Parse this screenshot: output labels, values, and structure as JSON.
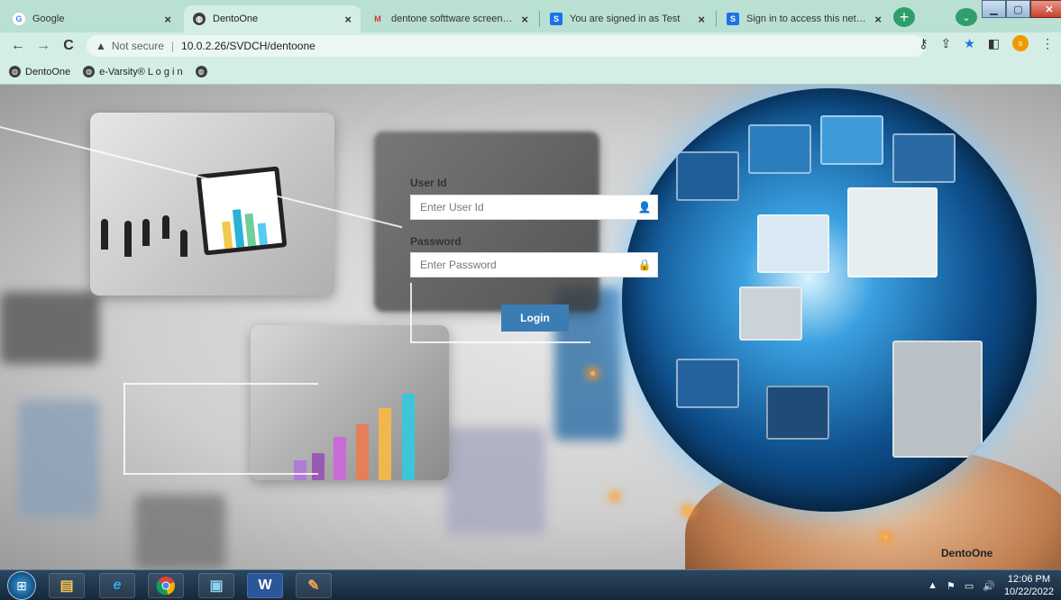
{
  "browser": {
    "tabs": [
      {
        "title": "Google",
        "icon": "google-icon"
      },
      {
        "title": "DentoOne",
        "icon": "globe-icon",
        "active": true
      },
      {
        "title": "dentone softtware screenshot",
        "icon": "gmail-icon"
      },
      {
        "title": "You are signed in as Test",
        "icon": "s-icon"
      },
      {
        "title": "Sign in to access this network",
        "icon": "s-icon"
      }
    ],
    "new_tab_label": "+",
    "address": {
      "security": "Not secure",
      "url": "10.0.2.26/SVDCH/dentoone"
    },
    "profile_initial": "s",
    "bookmarks": [
      {
        "label": "DentoOne"
      },
      {
        "label": "e-Varsity® L o g i n"
      },
      {
        "label": ""
      }
    ]
  },
  "login": {
    "userid_label": "User Id",
    "userid_placeholder": "Enter User Id",
    "password_label": "Password",
    "password_placeholder": "Enter Password",
    "login_button": "Login"
  },
  "brand": "DentoOne",
  "taskbar": {
    "time": "12:06 PM",
    "date": "10/22/2022"
  },
  "colors": {
    "browser_frame": "#b9e0d3",
    "active_tab": "#d4eee5",
    "login_button": "#3a7db5",
    "taskbar": "#1f3850"
  }
}
